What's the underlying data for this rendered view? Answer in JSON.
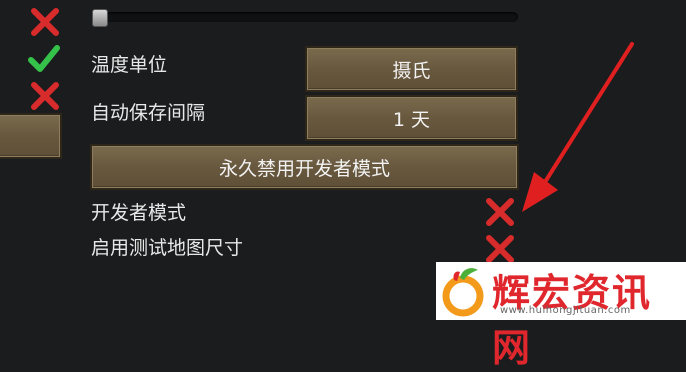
{
  "settings": {
    "temperature_unit": {
      "label": "温度单位",
      "value": "摄氏"
    },
    "autosave_interval": {
      "label": "自动保存间隔",
      "value": "1 天"
    },
    "disable_dev_mode_button": "永久禁用开发者模式",
    "developer_mode": {
      "label": "开发者模式",
      "enabled": false
    },
    "test_map_sizes": {
      "label": "启用测试地图尺寸",
      "enabled": false
    },
    "slider": {
      "level": 0.0
    }
  },
  "left_column_toggles": [
    {
      "name": "toggle-1",
      "state": "off"
    },
    {
      "name": "toggle-2",
      "state": "on"
    },
    {
      "name": "toggle-3",
      "state": "off"
    }
  ],
  "colors": {
    "background": "#1b1c1d",
    "button_wood": "#6c5c41",
    "cross_red": "#d82b2b",
    "check_green": "#35c24a",
    "annotation_red": "#e02020"
  },
  "watermark": {
    "title": "辉宏资讯网",
    "url": "www.huihongjituan.com"
  }
}
